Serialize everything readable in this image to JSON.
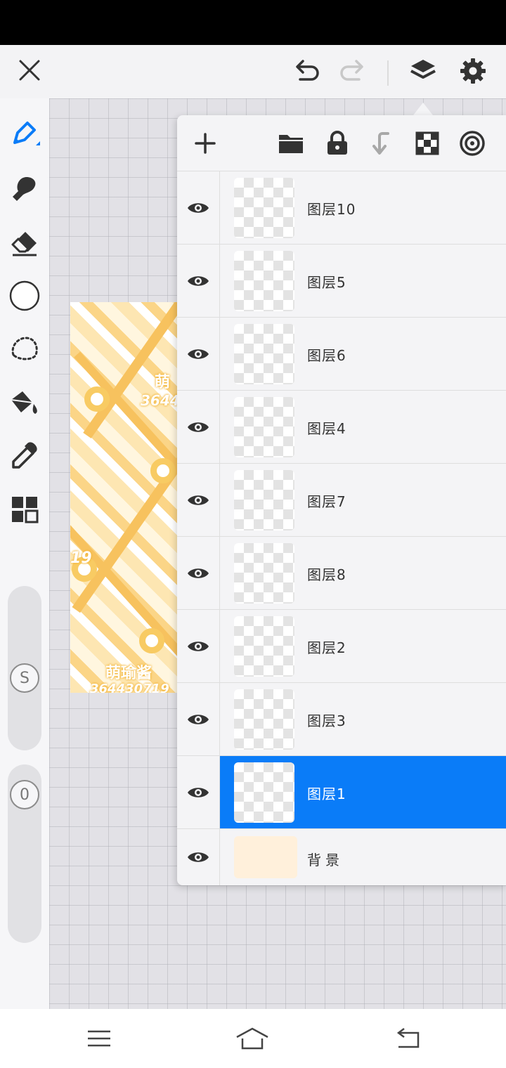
{
  "top_bar": {
    "close_icon": "close-icon",
    "undo_icon": "undo-icon",
    "redo_icon": "redo-icon",
    "layers_icon": "layers-icon",
    "settings_icon": "gear-icon"
  },
  "left_toolbar": {
    "tools": [
      "pen-icon",
      "smudge-brush-icon",
      "eraser-icon",
      "color-circle-icon",
      "lasso-select-icon",
      "fill-bucket-icon",
      "eyedropper-icon",
      "grid-tiles-icon"
    ],
    "size_slider_label": "S",
    "opacity_slider_label": "0"
  },
  "artwork": {
    "text_top": "萌",
    "text_top_digits": "3644",
    "text_side": "19",
    "text_bottom": "萌瑜酱",
    "text_bottom_digits": "364430719"
  },
  "layers_panel": {
    "toolbar": [
      "add-layer-icon",
      "folder-icon",
      "lock-icon",
      "merge-down-icon",
      "transparency-checker-icon",
      "target-icon"
    ],
    "layers": [
      {
        "name": "图层10",
        "visible": true,
        "selected": false
      },
      {
        "name": "图层5",
        "visible": true,
        "selected": false
      },
      {
        "name": "图层6",
        "visible": true,
        "selected": false
      },
      {
        "name": "图层4",
        "visible": true,
        "selected": false
      },
      {
        "name": "图层7",
        "visible": true,
        "selected": false
      },
      {
        "name": "图层8",
        "visible": true,
        "selected": false
      },
      {
        "name": "图层2",
        "visible": true,
        "selected": false
      },
      {
        "name": "图层3",
        "visible": true,
        "selected": false
      },
      {
        "name": "图层1",
        "visible": true,
        "selected": true
      }
    ],
    "background_layer": {
      "name": "背景",
      "visible": true
    },
    "selected_color": "#0a7cf8",
    "background_color": "#fff0db"
  },
  "nav_bar": {
    "menu_icon": "menu-icon",
    "home_icon": "home-icon",
    "back_icon": "back-icon"
  }
}
